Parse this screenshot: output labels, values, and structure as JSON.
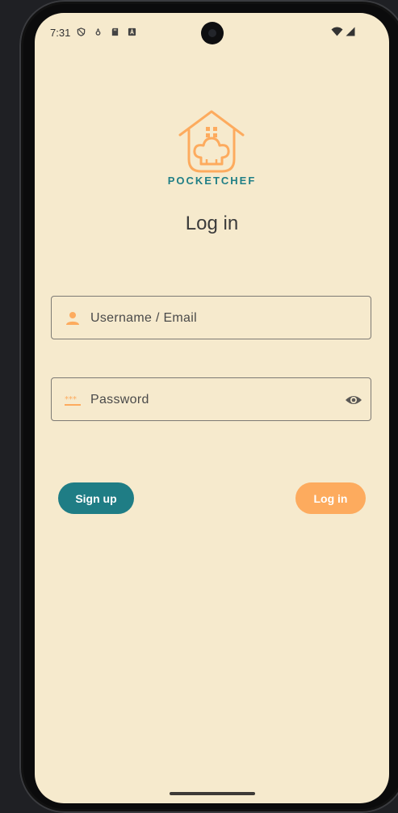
{
  "status_bar": {
    "time": "7:31",
    "left_icons": [
      "shield-icon",
      "location-icon",
      "sd-card-icon",
      "text-icon"
    ],
    "right_icons": [
      "wifi-icon",
      "signal-icon"
    ]
  },
  "brand": {
    "name": "POCKETCHEF",
    "logo_icon": "house-chef-hat-icon",
    "colors": {
      "primary": "#1f7d85",
      "accent": "#fdab5e",
      "background": "#f6eacd"
    }
  },
  "page_title": "Log in",
  "form": {
    "username": {
      "placeholder": "Username / Email",
      "icon": "person-icon"
    },
    "password": {
      "placeholder": "Password",
      "icon": "password-icon",
      "toggle_icon": "eye-icon"
    }
  },
  "buttons": {
    "signup_label": "Sign up",
    "login_label": "Log in"
  }
}
